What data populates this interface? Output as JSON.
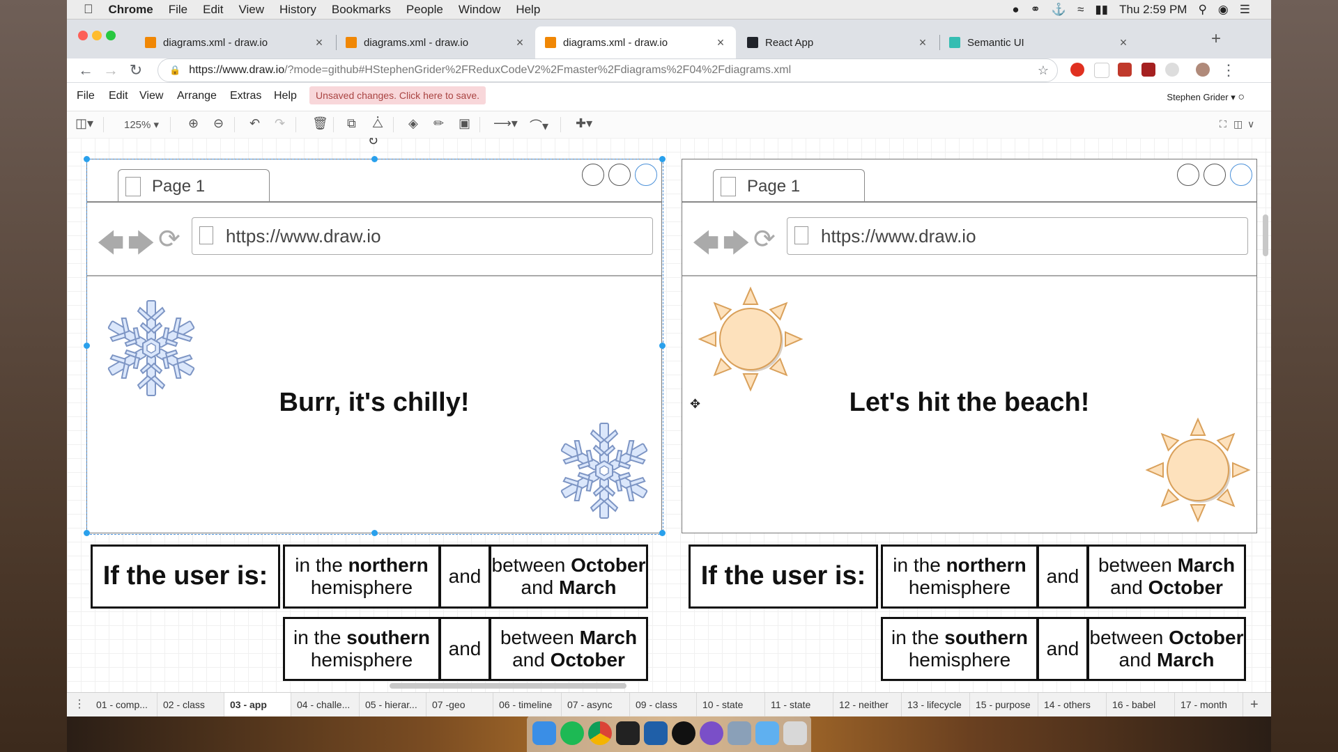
{
  "menubar": {
    "app": "Chrome",
    "items": [
      "File",
      "Edit",
      "View",
      "History",
      "Bookmarks",
      "People",
      "Window",
      "Help"
    ],
    "clock": "Thu 2:59 PM"
  },
  "tabs": [
    {
      "title": "diagrams.xml - draw.io",
      "active": false
    },
    {
      "title": "diagrams.xml - draw.io",
      "active": false
    },
    {
      "title": "diagrams.xml - draw.io",
      "active": true
    },
    {
      "title": "React App",
      "active": false
    },
    {
      "title": "Semantic UI",
      "active": false
    }
  ],
  "address": {
    "host": "https://www.draw.io",
    "rest": "/?mode=github#HStephenGrider%2FReduxCodeV2%2Fmaster%2Fdiagrams%2F04%2Fdiagrams.xml"
  },
  "drawio_menu": {
    "items": [
      "File",
      "Edit",
      "View",
      "Arrange",
      "Extras",
      "Help"
    ],
    "unsaved": "Unsaved changes. Click here to save.",
    "user": "Stephen Grider"
  },
  "toolbar": {
    "zoom": "125%"
  },
  "left_mock": {
    "page_tab": "Page 1",
    "url": "https://www.draw.io",
    "headline": "Burr, it's chilly!"
  },
  "right_mock": {
    "page_tab": "Page 1",
    "url": "https://www.draw.io",
    "headline": "Let's hit the beach!"
  },
  "left_table": {
    "label": "If the user is:",
    "row1": {
      "hemi_pre": "in the ",
      "hemi_bold": "northern",
      "hemi_post": "hemisphere",
      "and": "and",
      "p1": "between ",
      "b1": "October",
      "p2": "and ",
      "b2": "March"
    },
    "row2": {
      "hemi_pre": "in the ",
      "hemi_bold": "southern",
      "hemi_post": "hemisphere",
      "and": "and",
      "p1": "between ",
      "b1": "March",
      "p2": "and ",
      "b2": "October"
    }
  },
  "right_table": {
    "label": "If the user is:",
    "row1": {
      "hemi_pre": "in the ",
      "hemi_bold": "northern",
      "hemi_post": "hemisphere",
      "and": "and",
      "p1": "between ",
      "b1": "March",
      "p2": "and ",
      "b2": "October"
    },
    "row2": {
      "hemi_pre": "in the ",
      "hemi_bold": "southern",
      "hemi_post": "hemisphere",
      "and": "and",
      "p1": "between ",
      "b1": "October",
      "p2": "and ",
      "b2": "March"
    }
  },
  "page_tabs": [
    {
      "label": "01 - comp...",
      "active": false
    },
    {
      "label": "02 - class",
      "active": false
    },
    {
      "label": "03 - app",
      "active": true
    },
    {
      "label": "04 - challe...",
      "active": false
    },
    {
      "label": "05 - hierar...",
      "active": false
    },
    {
      "label": "07 -geo",
      "active": false
    },
    {
      "label": "06 - timeline",
      "active": false
    },
    {
      "label": "07 - async",
      "active": false
    },
    {
      "label": "09 - class",
      "active": false
    },
    {
      "label": "10 - state",
      "active": false
    },
    {
      "label": "11 - state",
      "active": false
    },
    {
      "label": "12 - neither",
      "active": false
    },
    {
      "label": "13 - lifecycle",
      "active": false
    },
    {
      "label": "15 - purpose",
      "active": false
    },
    {
      "label": "14 - others",
      "active": false
    },
    {
      "label": "16 - babel",
      "active": false
    },
    {
      "label": "17 - month",
      "active": false
    }
  ],
  "colors": {
    "snow_fill": "#dbe7fb",
    "snow_stroke": "#7d95c4",
    "sun_fill": "#fde1bc",
    "sun_stroke": "#d9a05a",
    "selection": "#29a0ec"
  }
}
